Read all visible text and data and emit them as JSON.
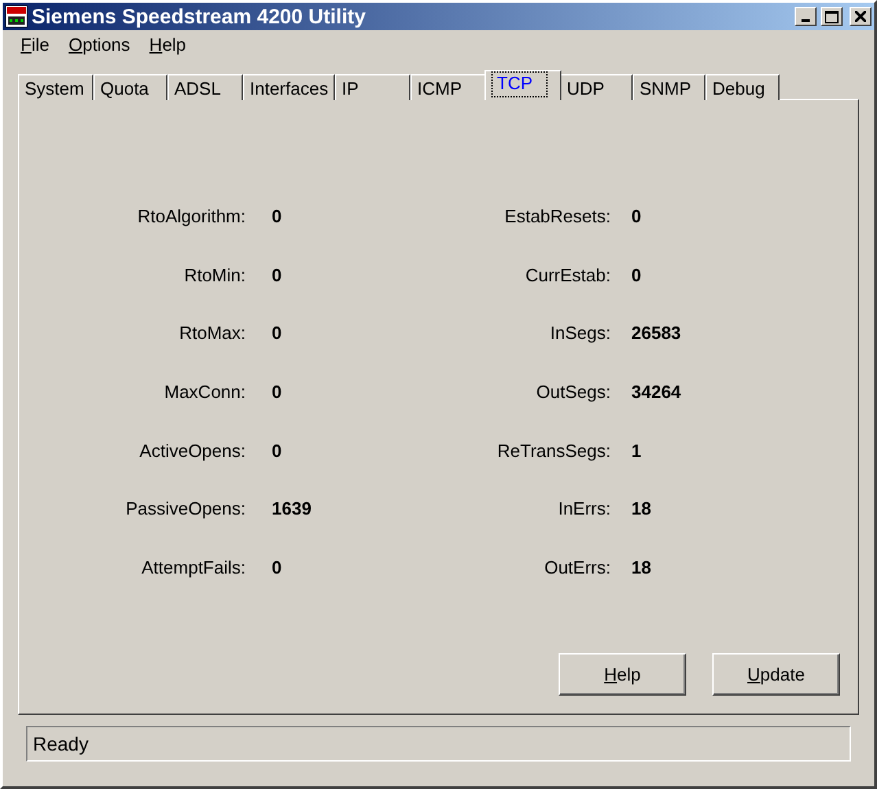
{
  "window": {
    "title": "Siemens Speedstream 4200 Utility"
  },
  "menu": [
    "File",
    "Options",
    "Help"
  ],
  "tabs": [
    {
      "label": "System",
      "selected": false
    },
    {
      "label": "Quota",
      "selected": false
    },
    {
      "label": "ADSL",
      "selected": false
    },
    {
      "label": "Interfaces",
      "selected": false
    },
    {
      "label": "IP",
      "selected": false
    },
    {
      "label": "ICMP",
      "selected": false
    },
    {
      "label": "TCP",
      "selected": true
    },
    {
      "label": "UDP",
      "selected": false
    },
    {
      "label": "SNMP",
      "selected": false
    },
    {
      "label": "Debug",
      "selected": false
    }
  ],
  "left_stats": [
    {
      "label": "RtoAlgorithm:",
      "value": "0"
    },
    {
      "label": "RtoMin:",
      "value": "0"
    },
    {
      "label": "RtoMax:",
      "value": "0"
    },
    {
      "label": "MaxConn:",
      "value": "0"
    },
    {
      "label": "ActiveOpens:",
      "value": "0"
    },
    {
      "label": "PassiveOpens:",
      "value": "1639"
    },
    {
      "label": "AttemptFails:",
      "value": "0"
    }
  ],
  "right_stats": [
    {
      "label": "EstabResets:",
      "value": "0"
    },
    {
      "label": "CurrEstab:",
      "value": "0"
    },
    {
      "label": "InSegs:",
      "value": "26583"
    },
    {
      "label": "OutSegs:",
      "value": "34264"
    },
    {
      "label": "ReTransSegs:",
      "value": "1"
    },
    {
      "label": "InErrs:",
      "value": "18"
    },
    {
      "label": "OutErrs:",
      "value": "18"
    }
  ],
  "buttons": [
    "Help",
    "Update"
  ],
  "status_bar": "Ready"
}
